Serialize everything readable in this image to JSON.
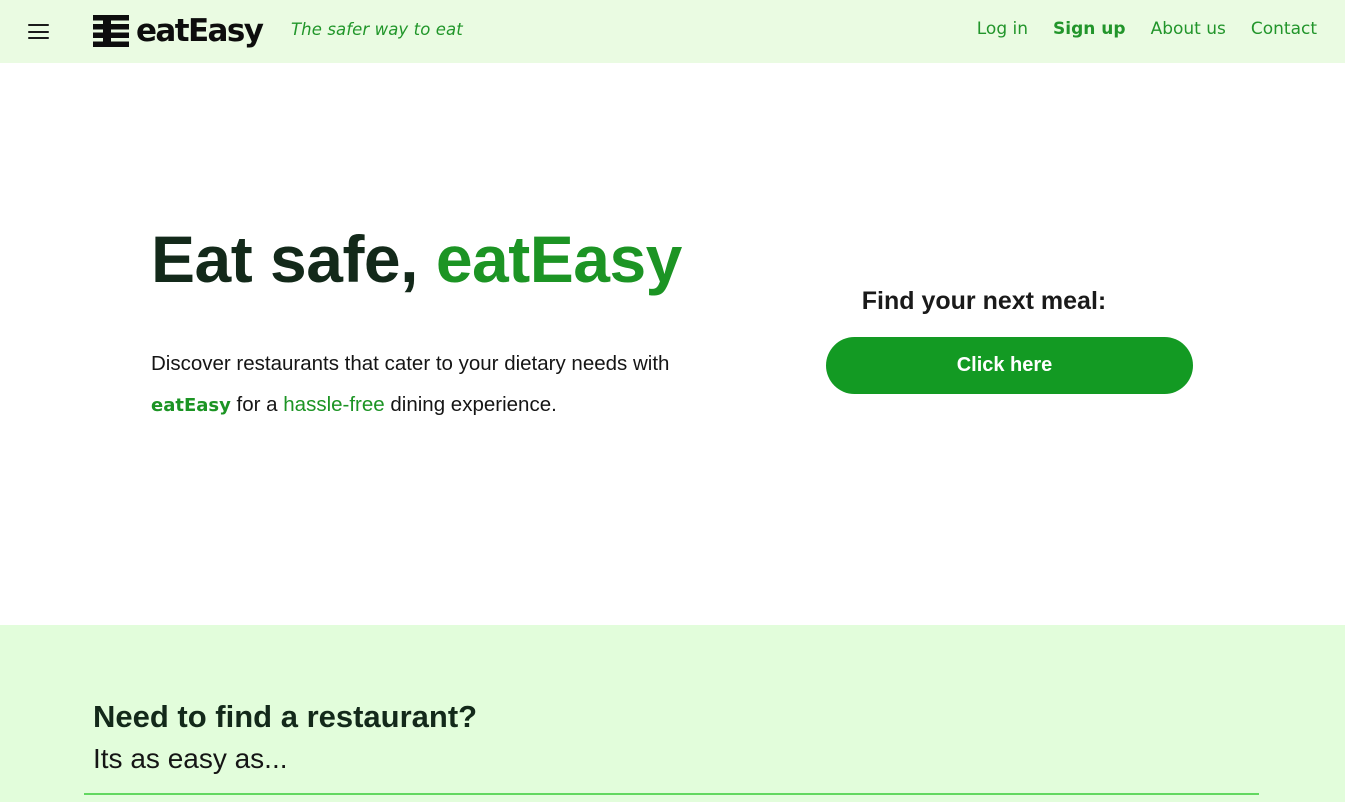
{
  "header": {
    "logo_text": "eatEasy",
    "tagline": "The safer way to eat",
    "nav": {
      "login": "Log in",
      "signup": "Sign up",
      "about": "About us",
      "contact": "Contact"
    }
  },
  "hero": {
    "title_part1": "Eat safe, ",
    "title_part2": "eatEasy",
    "desc_part1": "Discover restaurants that cater to your dietary needs with ",
    "desc_brand": "eatEasy",
    "desc_part2": " for a ",
    "desc_highlight": "hassle-free",
    "desc_part3": " dining experience."
  },
  "cta": {
    "label": "Find your next meal:",
    "button": "Click here"
  },
  "lower": {
    "heading": "Need to find a restaurant?",
    "subheading": "Its as easy as..."
  },
  "colors": {
    "header_bg": "#eafbe2",
    "accent_green": "#1c9424",
    "button_green": "#139a23",
    "lower_bg": "#e2fddb",
    "divider": "#62d860"
  },
  "icons": {
    "menu": "hamburger-menu-icon",
    "logo_mark": "eateasy-logo-mark-icon"
  }
}
